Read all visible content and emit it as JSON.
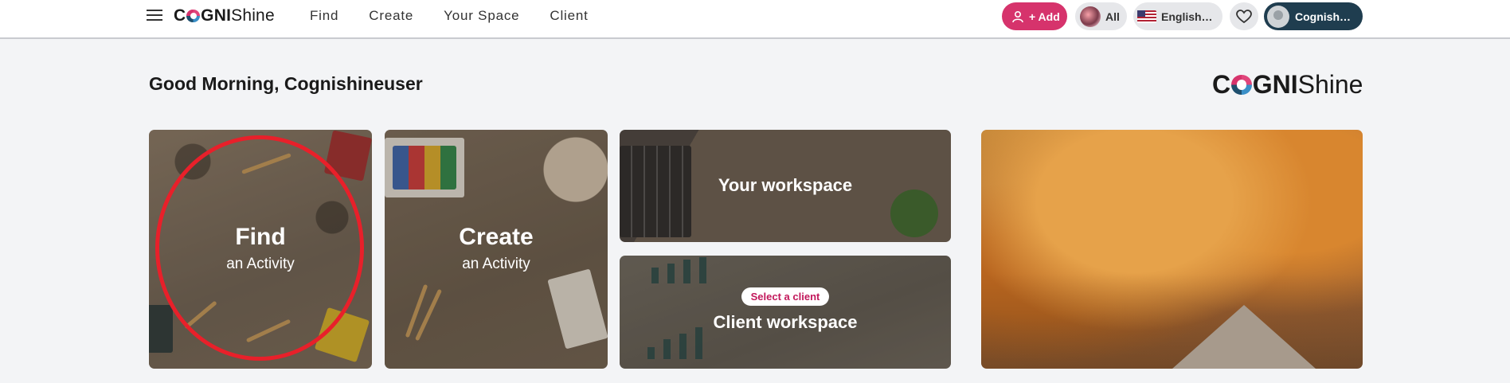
{
  "topbar": {
    "logo": {
      "part1": "C",
      "part2": "GNI",
      "part3": "Shine"
    },
    "nav": [
      "Find",
      "Create",
      "Your Space",
      "Client"
    ],
    "add_label": "+ Add",
    "all_label": "All",
    "language_label": "English…",
    "user_label": "Cognish…"
  },
  "greeting": "Good Morning, Cognishineuser",
  "brand_logo": {
    "part1": "C",
    "part2": "GNI",
    "part3": "Shine"
  },
  "tiles": {
    "find": {
      "title": "Find",
      "subtitle": "an Activity"
    },
    "create": {
      "title": "Create",
      "subtitle": "an Activity"
    },
    "workspace": {
      "title": "Your workspace"
    },
    "client": {
      "badge": "Select a client",
      "title": "Client workspace"
    }
  },
  "colors": {
    "accent": "#d6336c",
    "user_pill": "#1f3d4f",
    "annotation_circle": "#e8202a"
  }
}
